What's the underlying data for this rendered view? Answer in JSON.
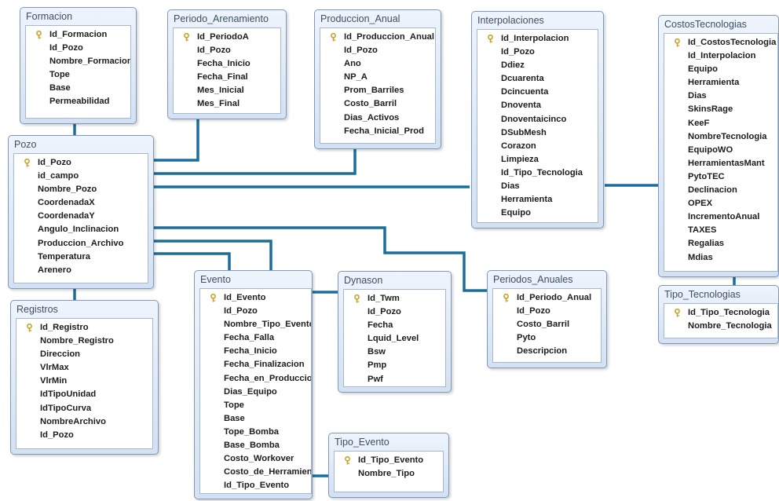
{
  "tables": {
    "formacion": {
      "name": "Formacion",
      "fields": [
        "Id_Formacion",
        "Id_Pozo",
        "Nombre_Formacion",
        "Tope",
        "Base",
        "Permeabilidad"
      ]
    },
    "periodo_arenamiento": {
      "name": "Periodo_Arenamiento",
      "fields": [
        "Id_PeriodoA",
        "Id_Pozo",
        "Fecha_Inicio",
        "Fecha_Final",
        "Mes_Inicial",
        "Mes_Final"
      ]
    },
    "produccion_anual": {
      "name": "Produccion_Anual",
      "fields": [
        "Id_Produccion_Anual",
        "Id_Pozo",
        "Ano",
        "NP_A",
        "Prom_Barriles",
        "Costo_Barril",
        "Dias_Activos",
        "Fecha_Inicial_Prod"
      ]
    },
    "interpolaciones": {
      "name": "Interpolaciones",
      "fields": [
        "Id_Interpolacion",
        "Id_Pozo",
        "Ddiez",
        "Dcuarenta",
        "Dcincuenta",
        "Dnoventa",
        "Dnoventaicinco",
        "DSubMesh",
        "Corazon",
        "Limpieza",
        "Id_Tipo_Tecnologia",
        "Dias",
        "Herramienta",
        "Equipo"
      ]
    },
    "costos_tecnologias": {
      "name": "CostosTecnologias",
      "fields": [
        "Id_CostosTecnologia",
        "Id_Interpolacion",
        "Equipo",
        "Herramienta",
        "Dias",
        "SkinsRage",
        "KeeF",
        "NombreTecnologia",
        "EquipoWO",
        "HerramientasMant",
        "PytoTEC",
        "Declinacion",
        "OPEX",
        "IncrementoAnual",
        "TAXES",
        "Regalias",
        "Mdias"
      ]
    },
    "pozo": {
      "name": "Pozo",
      "fields": [
        "Id_Pozo",
        "id_campo",
        "Nombre_Pozo",
        "CoordenadaX",
        "CoordenadaY",
        "Angulo_Inclinacion",
        "Produccion_Archivo",
        "Temperatura",
        "Arenero"
      ]
    },
    "registros": {
      "name": "Registros",
      "fields": [
        "Id_Registro",
        "Nombre_Registro",
        "Direccion",
        "VlrMax",
        "VlrMin",
        "IdTipoUnidad",
        "IdTipoCurva",
        "NombreArchivo",
        "Id_Pozo"
      ]
    },
    "evento": {
      "name": "Evento",
      "fields": [
        "Id_Evento",
        "Id_Pozo",
        "Nombre_Tipo_Evento",
        "Fecha_Falla",
        "Fecha_Inicio",
        "Fecha_Finalizacion",
        "Fecha_en_Produccion",
        "Dias_Equipo",
        "Tope",
        "Base",
        "Tope_Bomba",
        "Base_Bomba",
        "Costo_Workover",
        "Costo_de_Herramienta",
        "Id_Tipo_Evento"
      ]
    },
    "dynason": {
      "name": "Dynason",
      "fields": [
        "Id_Twm",
        "Id_Pozo",
        "Fecha",
        "Lquid_Level",
        "Bsw",
        "Pmp",
        "Pwf"
      ]
    },
    "periodos_anuales": {
      "name": "Periodos_Anuales",
      "fields": [
        "Id_Periodo_Anual",
        "Id_Pozo",
        "Costo_Barril",
        "Pyto",
        "Descripcion"
      ]
    },
    "tipo_tecnologias": {
      "name": "Tipo_Tecnologias",
      "fields": [
        "Id_Tipo_Tecnologia",
        "Nombre_Tecnologia"
      ]
    },
    "tipo_evento": {
      "name": "Tipo_Evento",
      "fields": [
        "Id_Tipo_Evento",
        "Nombre_Tipo"
      ]
    }
  },
  "colors": {
    "connector": "#1b6e9b",
    "header_gradient_top": "#eef4fc",
    "header_gradient_bottom": "#d3e1f3",
    "border": "#7f98bb",
    "key_icon": "#c9a227"
  },
  "icons": {
    "primary_key": "key-icon"
  }
}
